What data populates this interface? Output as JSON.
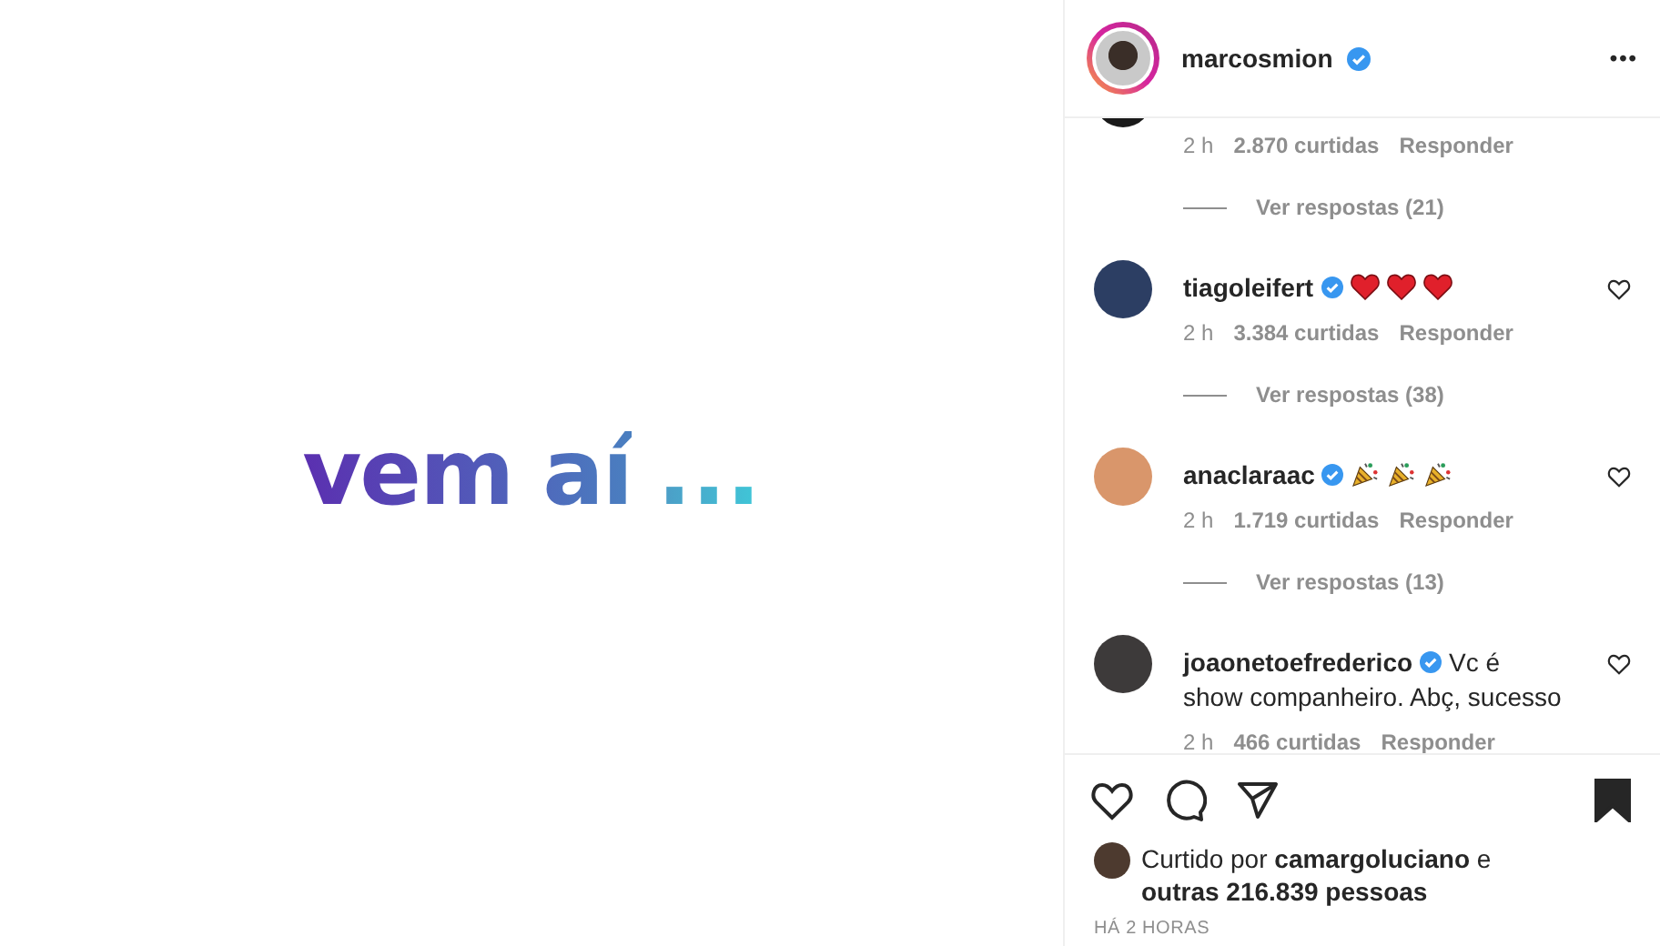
{
  "post_image": {
    "headline": "vem aí",
    "ellipsis": "..."
  },
  "header": {
    "username": "marcosmion",
    "verified": true,
    "more": "•••"
  },
  "comments": [
    {
      "time": "2 h",
      "likes": "2.870 curtidas",
      "reply": "Responder",
      "view_replies": "Ver respostas (21)"
    },
    {
      "username": "tiagoleifert",
      "verified": true,
      "reactions": [
        {
          "kind": "heart"
        },
        {
          "kind": "heart"
        },
        {
          "kind": "heart"
        }
      ],
      "time": "2 h",
      "likes": "3.384 curtidas",
      "reply": "Responder",
      "view_replies": "Ver respostas (38)"
    },
    {
      "username": "anaclaraac",
      "verified": true,
      "reactions": [
        {
          "kind": "party"
        },
        {
          "kind": "party"
        },
        {
          "kind": "party"
        }
      ],
      "time": "2 h",
      "likes": "1.719 curtidas",
      "reply": "Responder",
      "view_replies": "Ver respostas (13)"
    },
    {
      "username": "joaonetoefrederico",
      "verified": true,
      "text": "Vc é show companheiro. Abç, sucesso",
      "time": "2 h",
      "likes": "466 curtidas",
      "reply": "Responder"
    }
  ],
  "liked_by": {
    "prefix": "Curtido por",
    "user": "camargoluciano",
    "suffix": "e",
    "rest": "outras 216.839 pessoas"
  },
  "saved": true,
  "timestamp": "HÁ 2 HORAS"
}
